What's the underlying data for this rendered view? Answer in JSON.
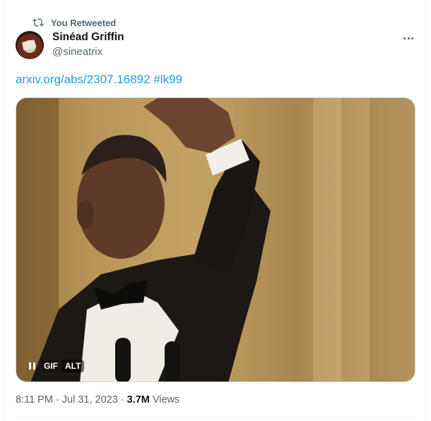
{
  "retweet": {
    "label": "You Retweeted",
    "icon": "retweet-icon"
  },
  "author": {
    "name": "Sinéad Griffin",
    "handle": "@sineatrix",
    "avatar": "avatar"
  },
  "tweet": {
    "link_text": "arxiv.org/abs/2307.16892",
    "hashtag": "#lk99"
  },
  "media": {
    "gif_label": "GIF",
    "alt_label": "ALT"
  },
  "meta": {
    "time": "8:11 PM",
    "sep1": "·",
    "date": "Jul 31, 2023",
    "sep2": "·",
    "views_count": "3.7M",
    "views_label": "Views"
  },
  "colors": {
    "accent": "#1d9bf0",
    "secondary_text": "#536471",
    "primary_text": "#0f1419"
  }
}
